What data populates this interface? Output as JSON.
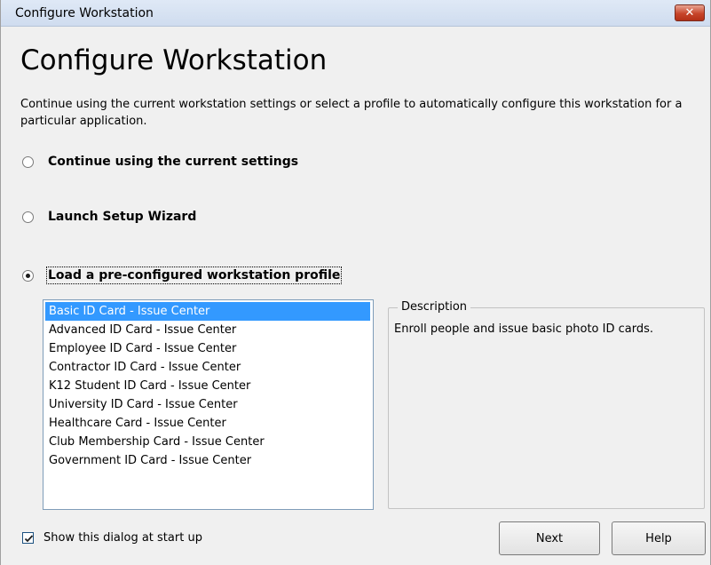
{
  "window": {
    "title": "Configure Workstation",
    "close_glyph": "✕"
  },
  "main": {
    "heading": "Configure Workstation",
    "intro": "Continue using the current workstation settings or select a profile to automatically configure this workstation for a particular application."
  },
  "options": [
    {
      "label": "Continue using the current settings",
      "checked": false
    },
    {
      "label": "Launch Setup Wizard",
      "checked": false
    },
    {
      "label": "Load a pre-configured workstation profile",
      "checked": true
    }
  ],
  "profiles": {
    "selected_index": 0,
    "items": [
      "Basic ID Card - Issue Center",
      "Advanced ID Card - Issue Center",
      "Employee ID Card - Issue Center",
      "Contractor ID Card - Issue Center",
      "K12 Student ID Card - Issue Center",
      "University ID Card - Issue Center",
      "Healthcare Card - Issue Center",
      "Club Membership Card - Issue Center",
      "Government ID Card - Issue Center"
    ]
  },
  "description": {
    "legend": "Description",
    "text": "Enroll people and issue basic photo ID cards."
  },
  "footer": {
    "show_at_startup_label": "Show this dialog at start up",
    "show_at_startup_checked": true,
    "next_label": "Next",
    "help_label": "Help"
  },
  "colors": {
    "selection": "#3399ff",
    "close_button": "#c7452a"
  }
}
